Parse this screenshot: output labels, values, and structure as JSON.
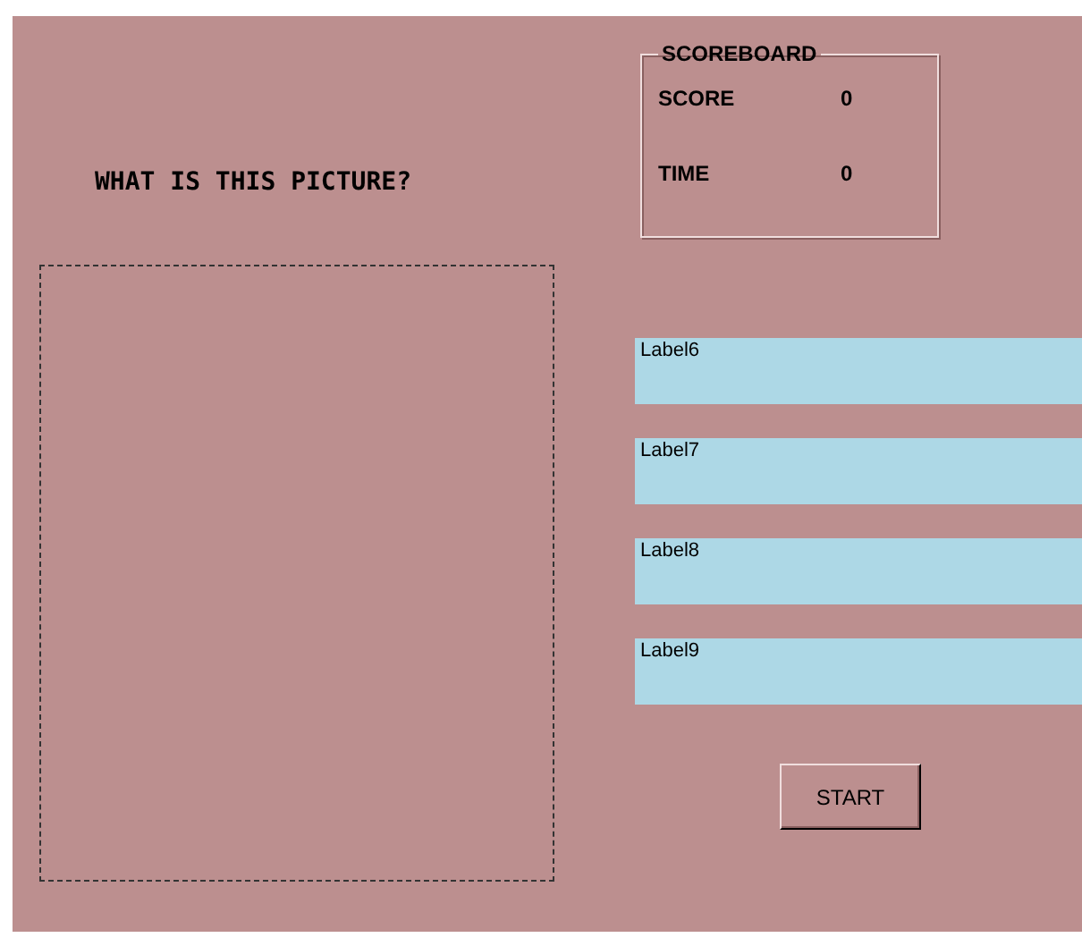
{
  "title": "WHAT IS THIS PICTURE?",
  "scoreboard": {
    "title": "SCOREBOARD",
    "rows": [
      {
        "label": "SCORE",
        "value": "0"
      },
      {
        "label": "TIME",
        "value": "0"
      }
    ]
  },
  "answers": [
    "Label6",
    "Label7",
    "Label8",
    "Label9"
  ],
  "start_button": "START"
}
